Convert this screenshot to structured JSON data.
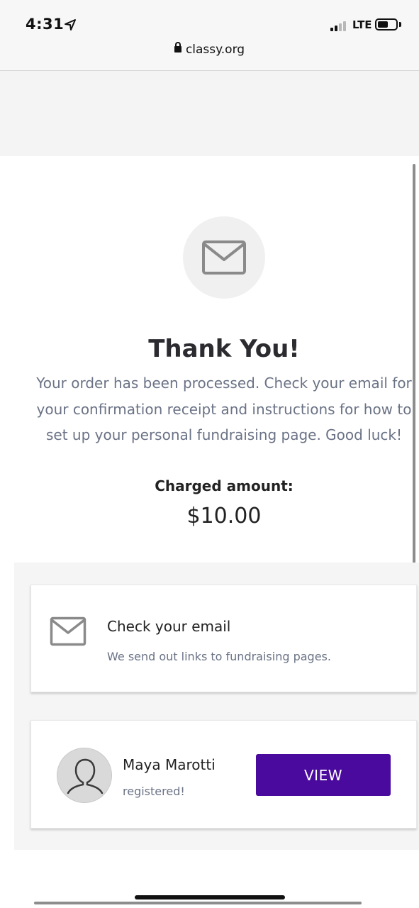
{
  "status_bar": {
    "time": "4:31",
    "network": "LTE",
    "icons": [
      "location-arrow-icon",
      "signal-icon",
      "battery-icon"
    ]
  },
  "browser": {
    "url": "classy.org",
    "lock_icon": "lock-icon"
  },
  "confirmation": {
    "icon": "envelope-icon",
    "title": "Thank You!",
    "message": "Your order has been processed. Check your email for your confirmation receipt and instructions for how to set up your personal fundraising page. Good luck!",
    "charged_label": "Charged amount:",
    "charged_amount": "$10.00"
  },
  "email_card": {
    "icon": "envelope-icon",
    "title": "Check your email",
    "subtitle": "We send out links to fundraising pages."
  },
  "registration_card": {
    "avatar_icon": "user-silhouette-icon",
    "name": "Maya Marotti",
    "status": "registered!",
    "button_label": "VIEW"
  },
  "colors": {
    "accent": "#4a0a9e",
    "body_text": "#6a7285",
    "heading_text": "#2c2c30",
    "icon_gray": "#8a8a8a"
  }
}
